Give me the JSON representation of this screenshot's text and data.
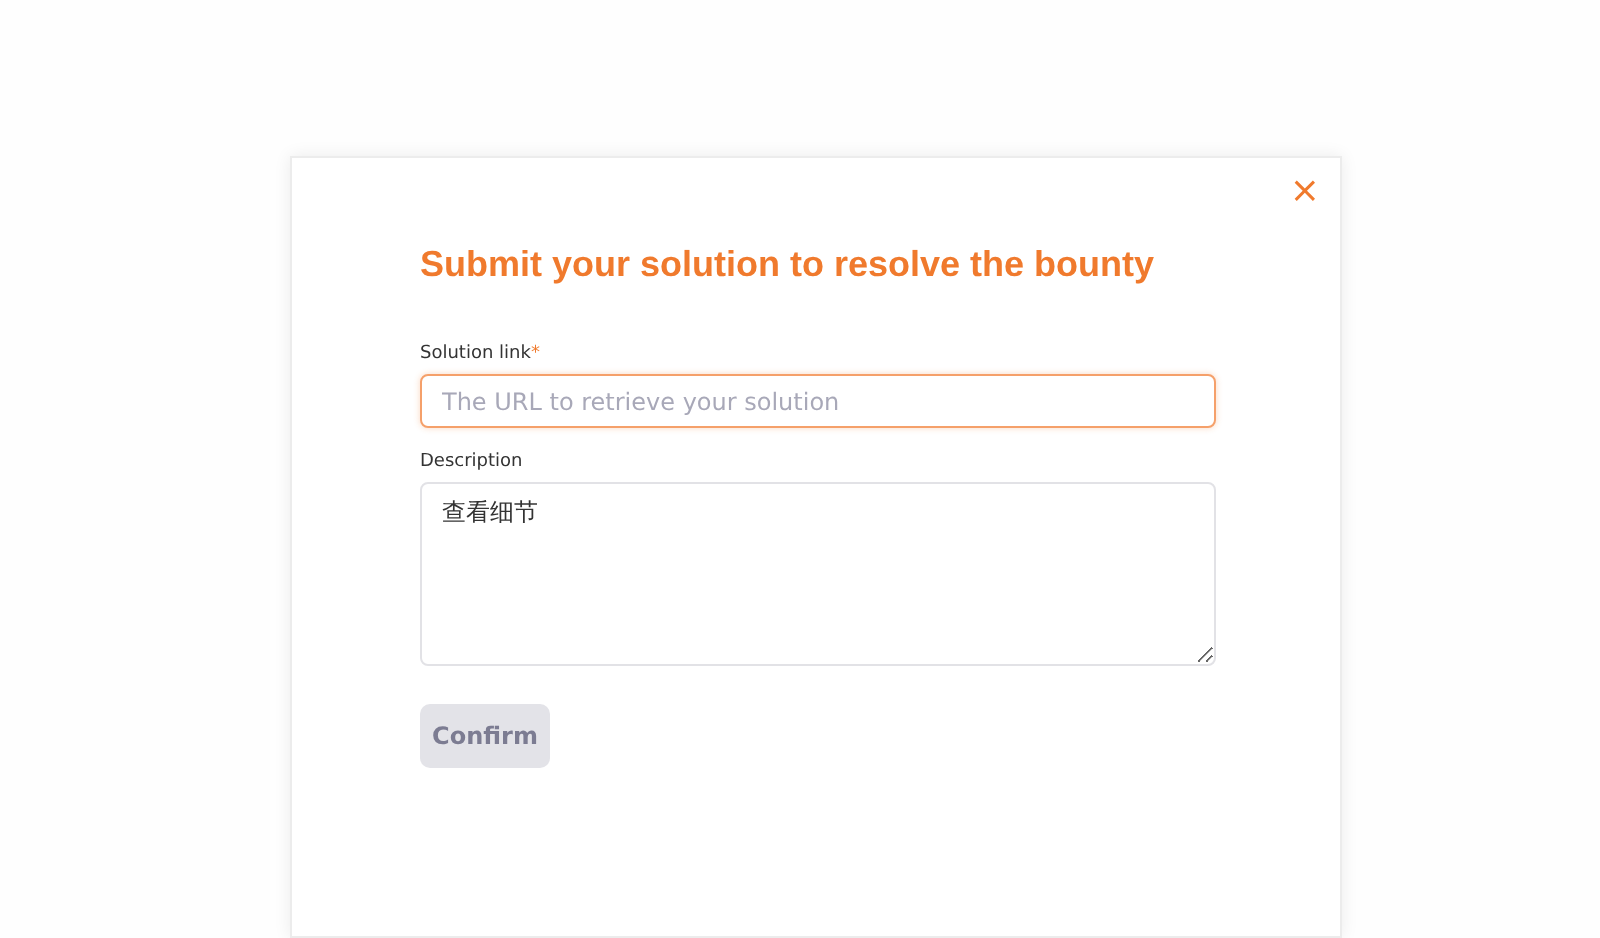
{
  "dialog": {
    "close": "×",
    "title": "Submit your solution to resolve the bounty",
    "fields": [
      {
        "kind": "input",
        "label": "Solution link",
        "required_mark": "*",
        "placeholder": "The URL to retrieve your solution",
        "focused": true
      },
      {
        "kind": "textarea",
        "label": "Description",
        "value": "查看细节",
        "focused": false
      }
    ],
    "confirm": {
      "label": "Confirm",
      "disabled": true
    }
  }
}
